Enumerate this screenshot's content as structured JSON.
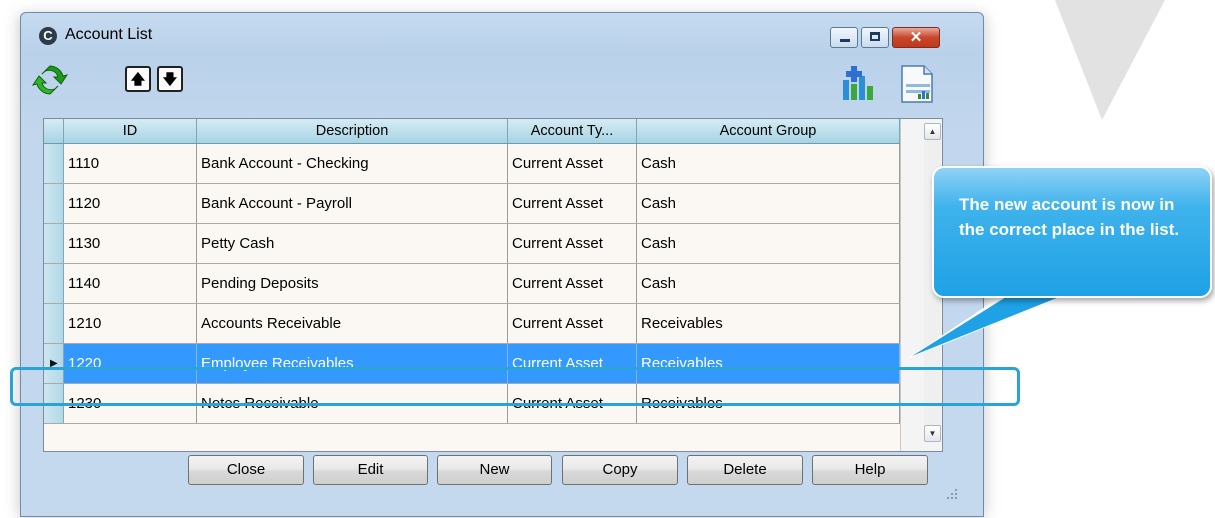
{
  "window": {
    "title": "Account List",
    "app_icon_glyph": "C",
    "close_glyph": "✕"
  },
  "toolbar": {
    "up_glyph": "🡅",
    "down_glyph": "🡇",
    "icons": [
      "refresh-icon",
      "move-up-arrow-icon",
      "move-down-arrow-icon",
      "add-chart-icon",
      "report-icon"
    ]
  },
  "grid": {
    "columns": [
      "ID",
      "Description",
      "Account Ty...",
      "Account Group"
    ],
    "rows": [
      {
        "id": "1110",
        "description": "Bank Account - Checking",
        "type": "Current Asset",
        "group": "Cash"
      },
      {
        "id": "1120",
        "description": "Bank Account - Payroll",
        "type": "Current Asset",
        "group": "Cash"
      },
      {
        "id": "1130",
        "description": "Petty Cash",
        "type": "Current Asset",
        "group": "Cash"
      },
      {
        "id": "1140",
        "description": "Pending Deposits",
        "type": "Current Asset",
        "group": "Cash"
      },
      {
        "id": "1210",
        "description": "Accounts Receivable",
        "type": "Current Asset",
        "group": "Receivables"
      },
      {
        "id": "1220",
        "description": "Employee Receivables",
        "type": "Current Asset",
        "group": "Receivables"
      },
      {
        "id": "1230",
        "description": "Notes Receivable",
        "type": "Current Asset",
        "group": "Receivables"
      }
    ],
    "selected_row_id": "1220",
    "selected_colors": {
      "background": "#3399ff",
      "text": "#ffffff"
    }
  },
  "buttons": {
    "close": "Close",
    "edit": "Edit",
    "new": "New",
    "copy": "Copy",
    "delete": "Delete",
    "help": "Help"
  },
  "callout": {
    "text": "The new account is now in the correct place in the list.",
    "color": "#1ea1e5"
  },
  "highlight": {
    "color": "#2aa3d7"
  }
}
